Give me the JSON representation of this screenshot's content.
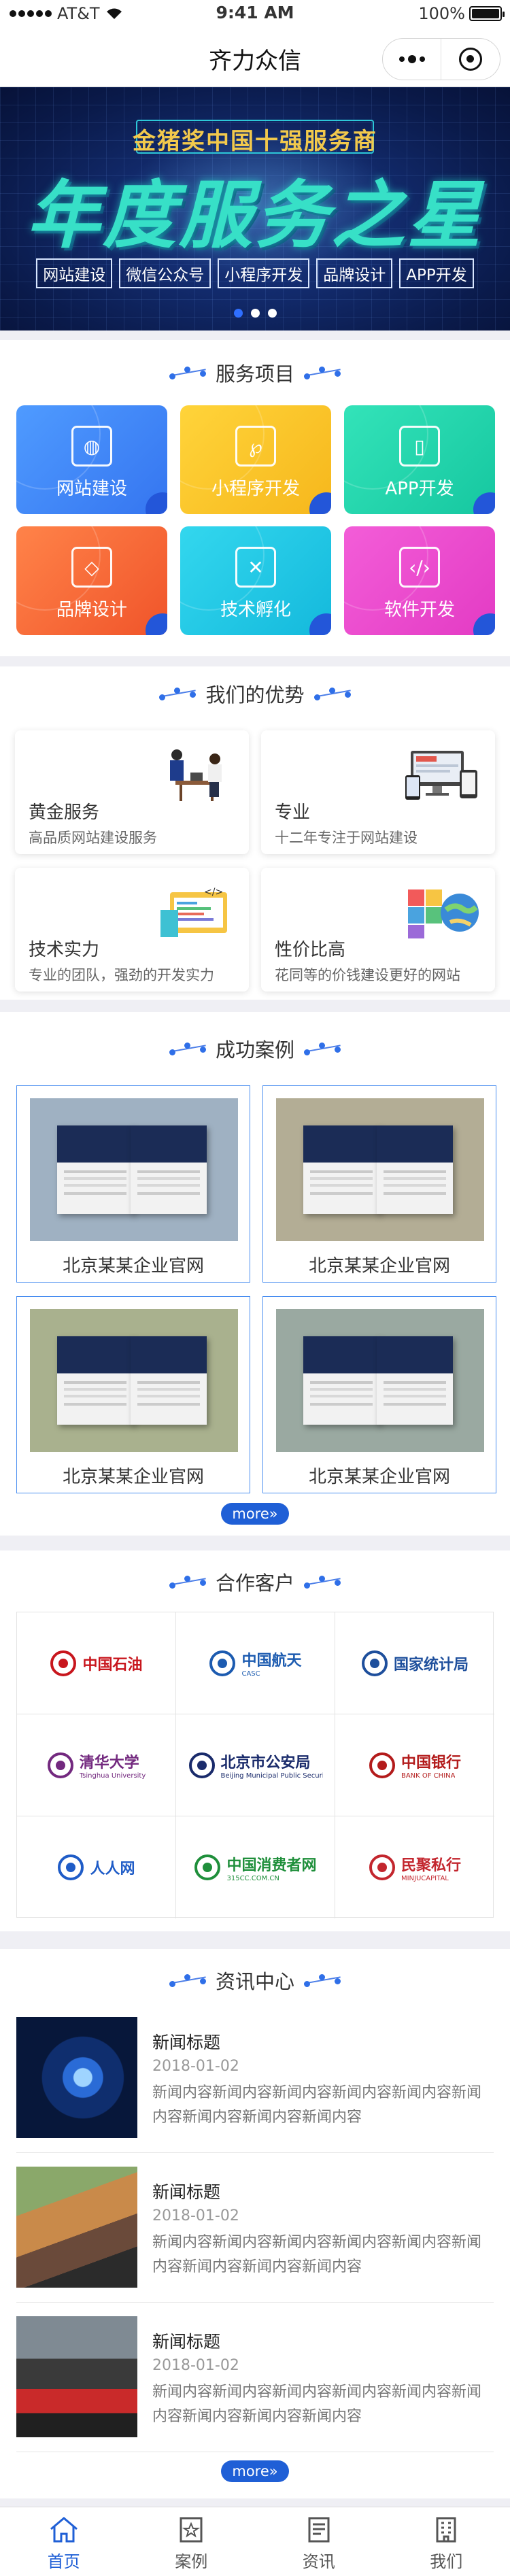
{
  "status_bar": {
    "carrier": "AT&T",
    "time": "9:41 AM",
    "battery": "100%",
    "battery_level": 1.0
  },
  "nav": {
    "title": "齐力众信"
  },
  "banner": {
    "subtitle": "金猪奖中国十强服务商",
    "title": "年度服务之星",
    "tags": [
      "网站建设",
      "微信公众号",
      "小程序开发",
      "品牌设计",
      "APP开发"
    ],
    "slide_count": 3,
    "active_slide": 1
  },
  "services": {
    "title": "服务项目",
    "items": [
      {
        "label": "网站建设",
        "icon": "globe-icon",
        "color_from": "#4f9bff",
        "color_to": "#3575f0"
      },
      {
        "label": "小程序开发",
        "icon": "mini-program-icon",
        "color_from": "#ffd43a",
        "color_to": "#f6b71c"
      },
      {
        "label": "APP开发",
        "icon": "phone-icon",
        "color_from": "#33e3b9",
        "color_to": "#16c7a0"
      },
      {
        "label": "品牌设计",
        "icon": "diamond-icon",
        "color_from": "#ff8349",
        "color_to": "#f0542a"
      },
      {
        "label": "技术孵化",
        "icon": "tools-icon",
        "color_from": "#33d7ee",
        "color_to": "#14b9dc"
      },
      {
        "label": "软件开发",
        "icon": "code-icon",
        "color_from": "#f35dd8",
        "color_to": "#e33bc4"
      }
    ]
  },
  "advantages": {
    "title": "我们的优势",
    "items": [
      {
        "title": "黄金服务",
        "desc": "高品质网站建设服务",
        "icon": "meeting-illustration-icon"
      },
      {
        "title": "专业",
        "desc": "十二年专注于网站建设",
        "icon": "devices-illustration-icon"
      },
      {
        "title": "技术实力",
        "desc": "专业的团队，强劲的开发实力",
        "icon": "code-illustration-icon"
      },
      {
        "title": "性价比高",
        "desc": "花同等的价钱建设更好的网站",
        "icon": "puzzle-globe-illustration-icon"
      }
    ]
  },
  "cases": {
    "title": "成功案例",
    "items": [
      {
        "label": "北京某某企业官网",
        "bg": "#9fb1c2"
      },
      {
        "label": "北京某某企业官网",
        "bg": "#b3ad95"
      },
      {
        "label": "北京某某企业官网",
        "bg": "#a9b18e"
      },
      {
        "label": "北京某某企业官网",
        "bg": "#9aa9a1"
      }
    ],
    "more": "more»"
  },
  "partners": {
    "title": "合作客户",
    "items": [
      {
        "name": "中国石油",
        "icon": "petrochina-logo-icon",
        "color": "#c8161d"
      },
      {
        "name": "中国航天",
        "sub": "CASC",
        "icon": "casc-logo-icon",
        "color": "#1c5bb0"
      },
      {
        "name": "国家统计局",
        "icon": "nbs-logo-icon",
        "color": "#1e4f9c"
      },
      {
        "name": "清华大学",
        "sub": "Tsinghua University",
        "icon": "tsinghua-logo-icon",
        "color": "#73297f"
      },
      {
        "name": "北京市公安局",
        "sub": "Beijing Municipal Public Security Bureau",
        "icon": "police-badge-icon",
        "color": "#1a2b6b"
      },
      {
        "name": "中国银行",
        "sub": "BANK OF CHINA",
        "icon": "boc-logo-icon",
        "color": "#b31b1b"
      },
      {
        "name": "人人网",
        "icon": "renren-logo-icon",
        "color": "#1f5cc7"
      },
      {
        "name": "中国消费者网",
        "sub": "315CC.COM.CN",
        "icon": "consumer-logo-icon",
        "color": "#1f8f3b"
      },
      {
        "name": "民聚私行",
        "sub": "MINJUCAPITAL",
        "icon": "minju-logo-icon",
        "color": "#c3262e"
      }
    ]
  },
  "news": {
    "title": "资讯中心",
    "items": [
      {
        "title": "新闻标题",
        "date": "2018-01-02",
        "content": "新闻内容新闻内容新闻内容新闻内容新闻内容新闻内容新闻内容新闻内容新闻内容",
        "thumb": "tech-eye-image"
      },
      {
        "title": "新闻标题",
        "date": "2018-01-02",
        "content": "新闻内容新闻内容新闻内容新闻内容新闻内容新闻内容新闻内容新闻内容新闻内容",
        "thumb": "reading-bench-image"
      },
      {
        "title": "新闻标题",
        "date": "2018-01-02",
        "content": "新闻内容新闻内容新闻内容新闻内容新闻内容新闻内容新闻内容新闻内容新闻内容",
        "thumb": "go-kart-image"
      }
    ],
    "more": "more»"
  },
  "tabbar": {
    "items": [
      {
        "label": "首页",
        "icon": "home-icon",
        "active": true
      },
      {
        "label": "案例",
        "icon": "case-icon",
        "active": false
      },
      {
        "label": "资讯",
        "icon": "news-icon",
        "active": false
      },
      {
        "label": "我们",
        "icon": "building-icon",
        "active": false
      }
    ]
  },
  "colors": {
    "accent": "#1f5fd6",
    "page_bg": "#efeff4"
  }
}
